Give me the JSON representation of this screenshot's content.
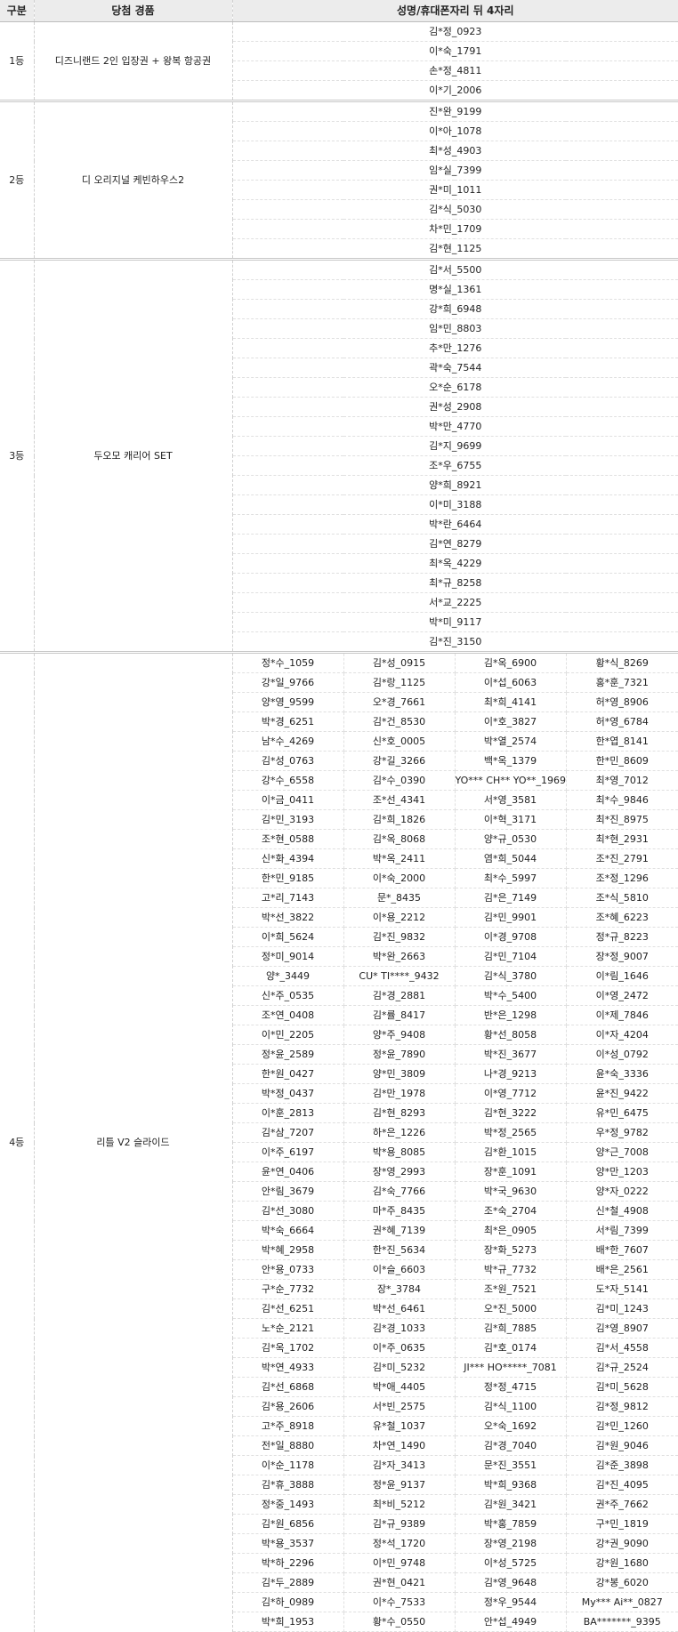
{
  "headers": {
    "grade": "구분",
    "prize": "당첨 경품",
    "winners": "성명/휴대폰자리 뒤 4자리"
  },
  "sections": [
    {
      "grade": "1등",
      "prize": "디즈니랜드 2인 입장권 + 왕복 항공권",
      "columns": 1,
      "names": [
        "김*정_0923",
        "이*숙_1791",
        "손*정_4811",
        "이*기_2006"
      ]
    },
    {
      "grade": "2등",
      "prize": "디 오리지널 케빈하우스2",
      "columns": 1,
      "names": [
        "진*완_9199",
        "이*아_1078",
        "최*성_4903",
        "임*실_7399",
        "권*미_1011",
        "김*식_5030",
        "차*민_1709",
        "김*현_1125"
      ]
    },
    {
      "grade": "3등",
      "prize": "두오모 캐리어 SET",
      "columns": 1,
      "names": [
        "김*서_5500",
        "명*실_1361",
        "강*희_6948",
        "임*민_8803",
        "추*만_1276",
        "곽*숙_7544",
        "오*순_6178",
        "권*성_2908",
        "박*만_4770",
        "김*지_9699",
        "조*우_6755",
        "양*희_8921",
        "이*미_3188",
        "박*란_6464",
        "김*연_8279",
        "최*옥_4229",
        "최*규_8258",
        "서*교_2225",
        "박*미_9117",
        "김*진_3150"
      ]
    },
    {
      "grade": "4등",
      "prize": "리틀 V2 슬라이드",
      "columns": 4,
      "names": [
        "정*수_1059",
        "김*성_0915",
        "김*옥_6900",
        "황*식_8269",
        "강*일_9766",
        "김*랑_1125",
        "이*섭_6063",
        "홍*훈_7321",
        "양*영_9599",
        "오*경_7661",
        "최*희_4141",
        "허*영_8906",
        "박*경_6251",
        "김*건_8530",
        "이*호_3827",
        "허*영_6784",
        "남*수_4269",
        "신*호_0005",
        "박*열_2574",
        "한*엽_8141",
        "김*성_0763",
        "강*길_3266",
        "백*옥_1379",
        "한*민_8609",
        "강*수_6558",
        "김*수_0390",
        "YO*** CH** YO**_1969",
        "최*영_7012",
        "이*금_0411",
        "조*선_4341",
        "서*영_3581",
        "최*수_9846",
        "김*민_3193",
        "김*희_1826",
        "이*혁_3171",
        "최*진_8975",
        "조*현_0588",
        "김*옥_8068",
        "양*규_0530",
        "최*현_2931",
        "신*화_4394",
        "박*옥_2411",
        "염*희_5044",
        "조*진_2791",
        "한*민_9185",
        "이*숙_2000",
        "최*수_5997",
        "조*정_1296",
        "고*리_7143",
        "문*_8435",
        "김*은_7149",
        "조*식_5810",
        "박*선_3822",
        "이*용_2212",
        "김*민_9901",
        "조*혜_6223",
        "이*희_5624",
        "김*진_9832",
        "이*경_9708",
        "정*규_8223",
        "정*미_9014",
        "박*완_2663",
        "김*민_7104",
        "장*정_9007",
        "양*_3449",
        "CU* TI****_9432",
        "김*식_3780",
        "이*림_1646",
        "신*주_0535",
        "김*경_2881",
        "박*수_5400",
        "이*영_2472",
        "조*연_0408",
        "김*률_8417",
        "반*은_1298",
        "이*제_7846",
        "이*민_2205",
        "양*주_9408",
        "황*선_8058",
        "이*자_4204",
        "정*윤_2589",
        "정*윤_7890",
        "박*진_3677",
        "이*성_0792",
        "한*원_0427",
        "양*민_3809",
        "나*경_9213",
        "윤*숙_3336",
        "박*정_0437",
        "김*만_1978",
        "이*영_7712",
        "윤*진_9422",
        "이*훈_2813",
        "김*현_8293",
        "김*현_3222",
        "유*민_6475",
        "김*삼_7207",
        "하*은_1226",
        "박*정_2565",
        "우*정_9782",
        "이*주_6197",
        "박*용_8085",
        "김*환_1015",
        "양*근_7008",
        "윤*연_0406",
        "장*영_2993",
        "장*훈_1091",
        "양*만_1203",
        "안*림_3679",
        "김*숙_7766",
        "박*국_9630",
        "양*자_0222",
        "김*선_3080",
        "마*주_8435",
        "조*숙_2704",
        "신*철_4908",
        "박*숙_6664",
        "권*혜_7139",
        "최*은_0905",
        "서*림_7399",
        "박*혜_2958",
        "한*진_5634",
        "장*화_5273",
        "배*한_7607",
        "안*용_0733",
        "이*슬_6603",
        "박*규_7732",
        "배*은_2561",
        "구*순_7732",
        "장*_3784",
        "조*원_7521",
        "도*자_5141",
        "김*선_6251",
        "박*선_6461",
        "오*진_5000",
        "김*미_1243",
        "노*순_2121",
        "김*경_1033",
        "김*희_7885",
        "김*영_8907",
        "김*옥_1702",
        "이*주_0635",
        "김*호_0174",
        "김*서_4558",
        "박*연_4933",
        "김*미_5232",
        "JI*** HO*****_7081",
        "김*규_2524",
        "김*선_6868",
        "박*애_4405",
        "정*정_4715",
        "김*미_5628",
        "김*용_2606",
        "서*빈_2575",
        "김*식_1100",
        "김*정_9812",
        "고*주_8918",
        "유*철_1037",
        "오*숙_1692",
        "김*민_1260",
        "전*일_8880",
        "차*연_1490",
        "김*경_7040",
        "김*원_9046",
        "이*순_1178",
        "김*자_3413",
        "문*진_3551",
        "김*준_3898",
        "김*휴_3888",
        "정*윤_9137",
        "박*희_9368",
        "김*진_4095",
        "정*중_1493",
        "최*비_5212",
        "김*원_3421",
        "권*주_7662",
        "김*원_6856",
        "김*규_9389",
        "박*홍_7859",
        "구*민_1819",
        "박*용_3537",
        "정*석_1720",
        "장*영_2198",
        "강*권_9090",
        "박*하_2296",
        "이*민_9748",
        "이*성_5725",
        "강*원_1680",
        "김*두_2889",
        "권*현_0421",
        "김*영_9648",
        "강*봉_6020",
        "김*하_0989",
        "이*수_7533",
        "정*우_9544",
        "My*** Ai**_0827",
        "박*희_1953",
        "황*수_0550",
        "안*섭_4949",
        "BA*******_9395"
      ]
    }
  ]
}
